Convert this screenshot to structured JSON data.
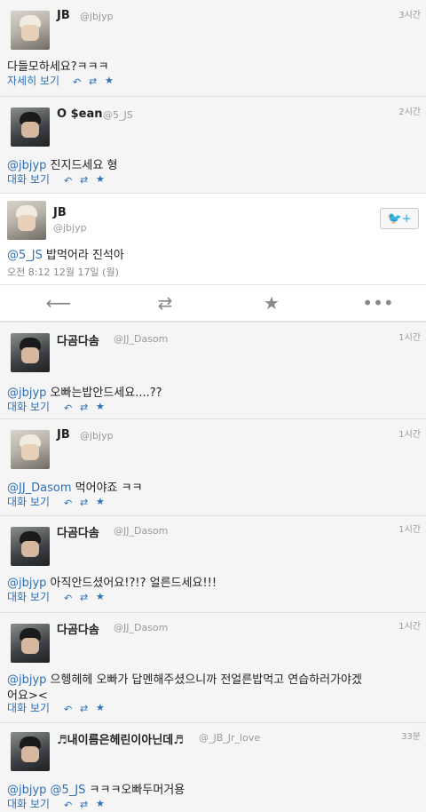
{
  "tweets": [
    {
      "name": "JB",
      "handle": "@jbjyp",
      "time": "3시간",
      "text": "다들모하세요?ㅋㅋㅋ",
      "action": "자세히 보기"
    },
    {
      "name": "O $ean",
      "handle": "@5_JS",
      "time": "2시간",
      "mention": "@jbjyp",
      "text": " 진지드세요 형",
      "action": "대화 보기"
    },
    {
      "name": "JB",
      "handle": "@jbjyp",
      "mention": "@5_JS",
      "text": " 밥먹어라 진석아",
      "meta": "오전 8:12 12월 17일 (월)"
    },
    {
      "name": "다곰다솜",
      "handle": "@JJ_Dasom",
      "time": "1시간",
      "mention": "@jbjyp",
      "text": " 오빠는밥안드세요....??",
      "action": "대화 보기"
    },
    {
      "name": "JB",
      "handle": "@jbjyp",
      "time": "1시간",
      "mention": "@JJ_Dasom",
      "text": " 먹어야죠 ㅋㅋ",
      "action": "대화 보기"
    },
    {
      "name": "다곰다솜",
      "handle": "@JJ_Dasom",
      "time": "1시간",
      "mention": "@jbjyp",
      "text": " 아직안드셨어요!?!? 얼른드세요!!!",
      "action": "대화 보기"
    },
    {
      "name": "다곰다솜",
      "handle": "@JJ_Dasom",
      "time": "1시간",
      "mention": "@jbjyp",
      "text": " 으헹헤헤 오빠가 답멘해주셨으니까 전얼른밥먹고 연습하러가야겠",
      "text2": "어요><",
      "action": "대화 보기"
    },
    {
      "name": "♬내이름은헤린이아닌데♬",
      "handle": "@_JB_Jr_love",
      "time": "33분",
      "mention": "@jbjyp @5_JS",
      "text": " ㅋㅋㅋ오빠두머거용",
      "action": "대화 보기"
    }
  ],
  "icons": {
    "reply": "reply-icon",
    "retweet": "retweet-icon",
    "favorite": "star-icon",
    "more": "more-icon",
    "share": "twitter-bird-plus-icon"
  },
  "colors": {
    "link": "#2f6fb5",
    "bird": "#2aa3ef"
  }
}
